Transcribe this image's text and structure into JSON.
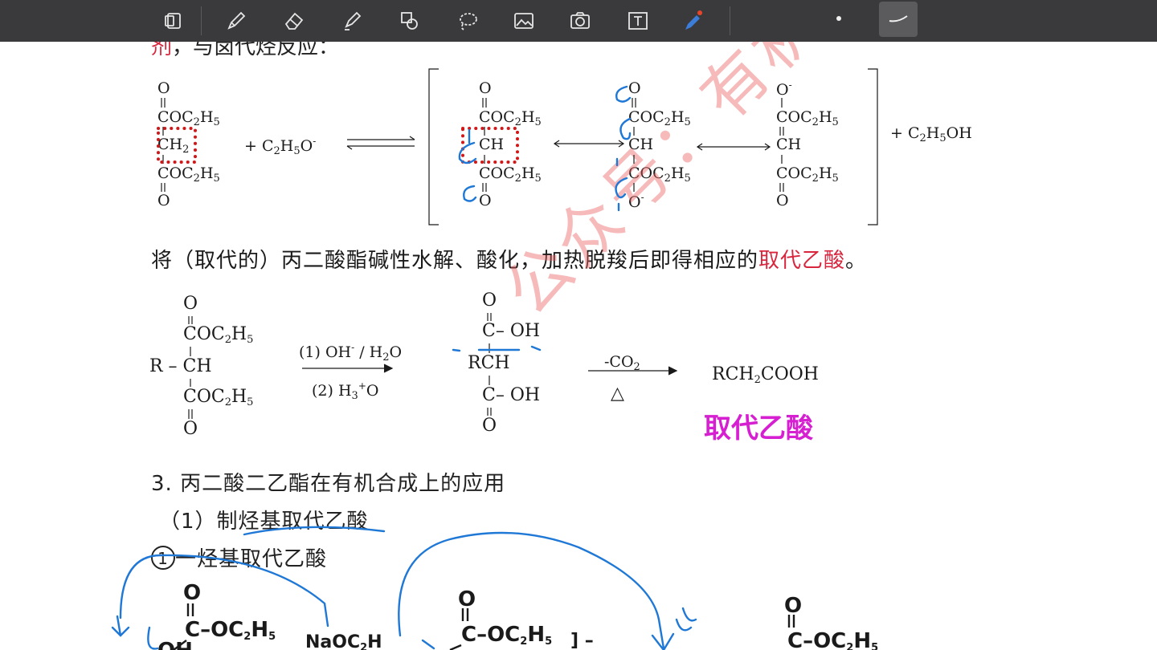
{
  "toolbar": {
    "tools": [
      {
        "name": "page-layout-icon"
      },
      {
        "name": "pen-icon"
      },
      {
        "name": "eraser-icon"
      },
      {
        "name": "highlighter-icon"
      },
      {
        "name": "shapes-icon"
      },
      {
        "name": "lasso-icon"
      },
      {
        "name": "image-icon"
      },
      {
        "name": "camera-icon"
      },
      {
        "name": "text-icon"
      },
      {
        "name": "bluetooth-pencil-icon"
      }
    ]
  },
  "doc": {
    "cut_line": {
      "red": "剂",
      "rest": "，与卤代烃反应："
    },
    "eq1": {
      "plus_reagent": "+  C",
      "reagent_sub2": "2",
      "reagent_h": "H",
      "reagent_sub5": "5",
      "reagent_o": "O",
      "reagent_charge": "-",
      "product": "+ C",
      "product_sub2": "2",
      "product_h": "H",
      "product_sub5": "5",
      "product_oh": "OH",
      "o": "O",
      "o_minus": "-",
      "coc": "COC",
      "sub2": "2",
      "h": "H",
      "sub5": "5",
      "ch2": "CH",
      "ch": "CH",
      "cch": "C CH"
    },
    "paragraph": {
      "before": "将（取代的）丙二酸酯碱性水解、酸化，加热脱羧后即得相应的",
      "red": "取代乙酸",
      "after": "。"
    },
    "eq2": {
      "r_ch": "R – CH",
      "cond1": "(1) OH",
      "cond1_charge": "-",
      "cond1_rest": " / H",
      "cond1_sub": "2",
      "cond1_o": "O",
      "cond2": "(2) H",
      "cond2_sub": "3",
      "cond2_charge": "+",
      "cond2_o": "O",
      "cooh": "C– OH",
      "rch": "RCH",
      "minus_co2": "-CO",
      "co2_sub": "2",
      "delta": "△",
      "product": "RCH",
      "product_sub": "2",
      "product_rest": "COOH",
      "product_name": "取代乙酸"
    },
    "section3": "3.  丙二酸二乙酯在有机合成上的应用",
    "subsection1": "（1）制烃基取代乙酸",
    "item1_circle": "1",
    "item1": "一烃基取代乙酸",
    "bottom": {
      "o": "O",
      "c_oc": "C–OC",
      "sub2": "2",
      "h": "H",
      "sub5": "5",
      "oh": "OH",
      "na": "NaOC",
      "na_sub": "2",
      "na_h": "H",
      "bracket": "] –"
    },
    "watermark": "公众号：有机化学考研"
  },
  "colors": {
    "toolbar_bg": "#3a3a3c",
    "ink_blue": "#1f78d6",
    "annotation_red": "#d01818",
    "red_text": "#d7263d",
    "magenta": "#d61fd0",
    "watermark": "#ec5a5a"
  }
}
